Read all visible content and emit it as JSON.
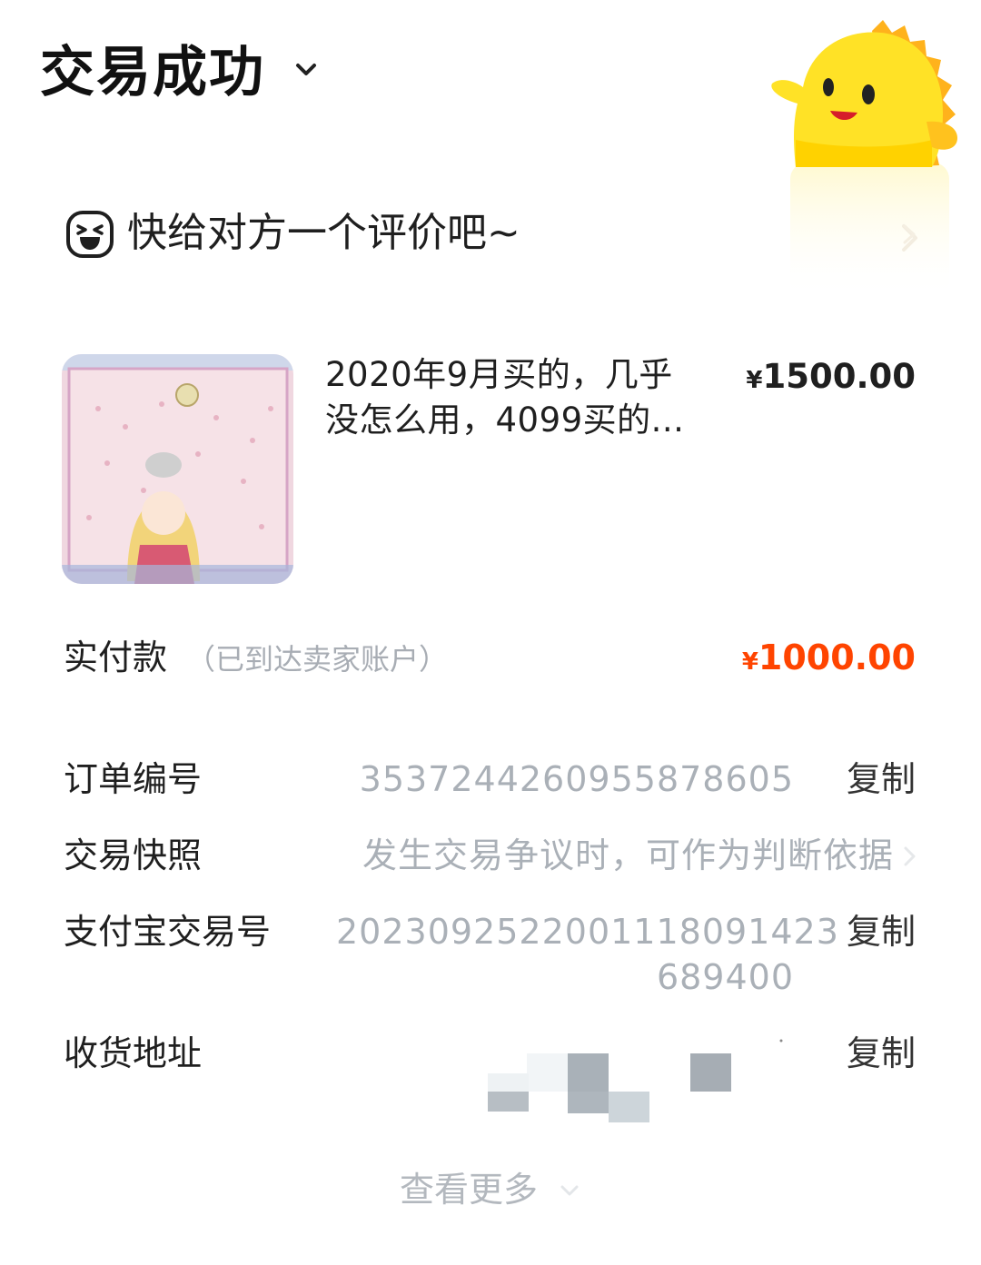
{
  "header": {
    "title": "交易成功",
    "chevron_icon": "chevron-down-icon",
    "mascot_icon": "yellow-fish-mascot-icon"
  },
  "review": {
    "icon": "laughing-face-icon",
    "text": "快给对方一个评价吧~",
    "chevron_icon": "chevron-right-icon"
  },
  "product": {
    "thumbnail_icon": "product-photo-laptop-sailor-moon",
    "title_line1": "2020年9月买的，几乎",
    "title_line2": "没怎么用，4099买的...",
    "currency": "¥",
    "price": "1500.00"
  },
  "payment": {
    "label": "实付款",
    "note": "（已到达卖家账户）",
    "currency": "¥",
    "amount": "1000.00",
    "amount_color": "#ff4400"
  },
  "info": {
    "order_number": {
      "label": "订单编号",
      "value": "3537244260955878605",
      "copy": "复制"
    },
    "snapshot": {
      "label": "交易快照",
      "value": "发生交易争议时，可作为判断依据",
      "chevron_icon": "chevron-right-icon"
    },
    "alipay": {
      "label": "支付宝交易号",
      "value_line1": "20230925220011180914 23",
      "value_line1_exact": "2023092522001118091423",
      "value_line2": "689400",
      "copy": "复制"
    },
    "address": {
      "label": "收货地址",
      "value_state": "blurred",
      "copy": "复制"
    }
  },
  "more": {
    "label": "查看更多",
    "chevron_icon": "chevron-down-icon"
  }
}
